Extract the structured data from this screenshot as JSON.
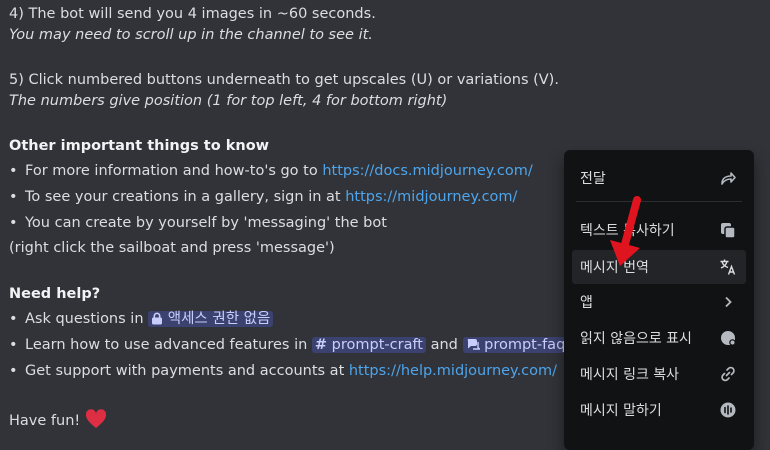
{
  "message": {
    "step4": "4) The bot will send you 4 images in ~60 seconds.",
    "step4_note": "You may need to scroll up in the channel to see it.",
    "step5": "5) Click numbered buttons underneath to get upscales (U) or variations (V).",
    "step5_note": "The numbers give position (1 for top left, 4 for bottom right)",
    "other_heading": "Other important things to know",
    "info_text": "For more information and how-to's go to ",
    "info_link": "https://docs.midjourney.com/",
    "gallery_text": "To see your creations in a gallery, sign in at ",
    "gallery_link": "https://midjourney.com/",
    "create_text": "You can create by yourself by 'messaging' the bot",
    "create_note": "(right click the sailboat and press 'message')",
    "help_heading": "Need help?",
    "ask_text": "Ask questions in ",
    "ask_mention": "액세스 권한 없음",
    "learn_text": "Learn how to use advanced features in ",
    "learn_mention1": "prompt-craft",
    "learn_and": " and ",
    "learn_mention2": "prompt-faqs",
    "support_text": "Get support with payments and accounts at ",
    "support_link": "https://help.midjourney.com/",
    "fun": "Have fun! "
  },
  "context_menu": {
    "items": [
      {
        "label": "전달",
        "icon": "forward-icon"
      },
      {
        "label": "텍스트 복사하기",
        "icon": "copy-icon"
      },
      {
        "label": "메시지 번역",
        "icon": "translate-icon"
      },
      {
        "label": "앱",
        "icon": "chevron-right-icon"
      },
      {
        "label": "읽지 않음으로 표시",
        "icon": "mark-unread-icon"
      },
      {
        "label": "메시지 링크 복사",
        "icon": "link-icon"
      },
      {
        "label": "메시지 말하기",
        "icon": "speak-icon"
      }
    ]
  },
  "colors": {
    "background": "#313338",
    "link": "#4ea5ec",
    "menu_bg": "#111214",
    "annotation_arrow": "#e0141e"
  }
}
